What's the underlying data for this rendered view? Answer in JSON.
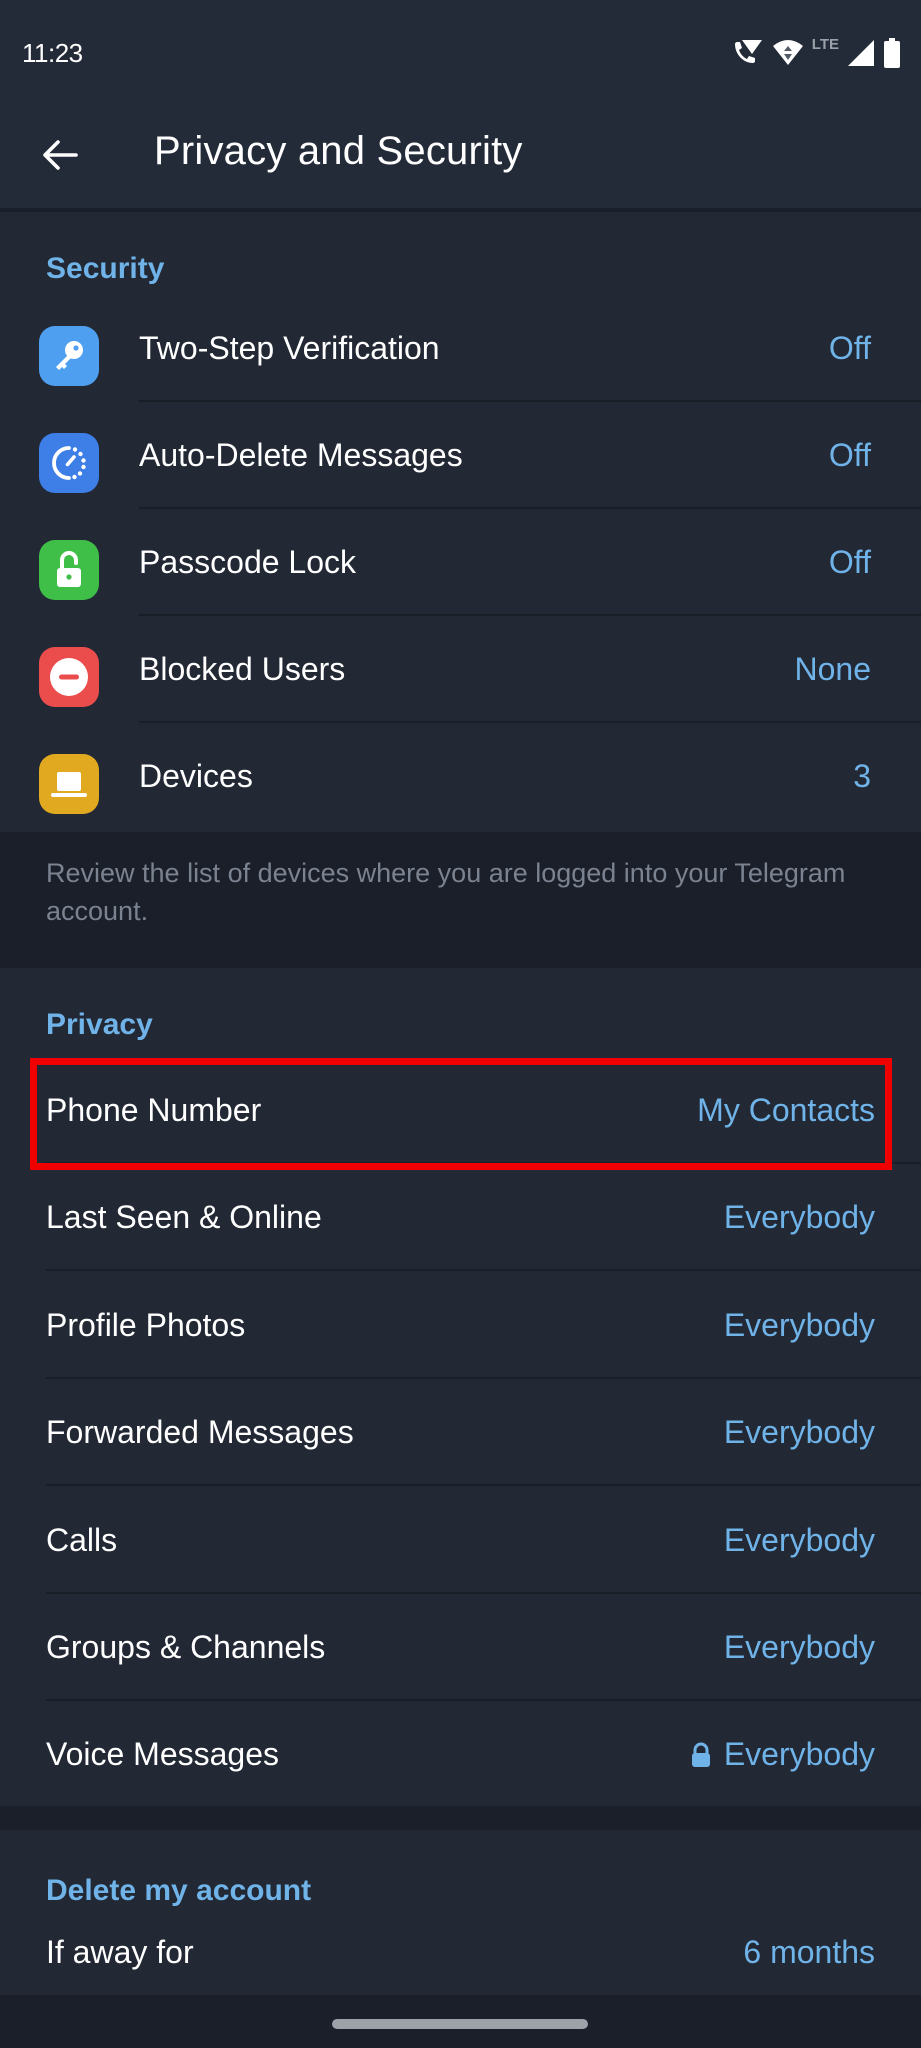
{
  "status_bar": {
    "time": "11:23",
    "network_label": "LTE",
    "icons": [
      "wifi-calling-icon",
      "wifi-icon",
      "signal-icon",
      "battery-icon"
    ]
  },
  "app_bar": {
    "back_icon": "arrow-left-icon",
    "title": "Privacy and Security"
  },
  "security": {
    "header": "Security",
    "items": [
      {
        "label": "Two-Step Verification",
        "value": "Off",
        "icon": "key-icon",
        "color": "#4f9ff0"
      },
      {
        "label": "Auto-Delete Messages",
        "value": "Off",
        "icon": "timer-icon",
        "color": "#3d7fe6"
      },
      {
        "label": "Passcode Lock",
        "value": "Off",
        "icon": "lock-open-icon",
        "color": "#3fbf48"
      },
      {
        "label": "Blocked Users",
        "value": "None",
        "icon": "block-icon",
        "color": "#eb4d4d"
      },
      {
        "label": "Devices",
        "value": "3",
        "icon": "laptop-icon",
        "color": "#e0a920"
      }
    ],
    "footer": "Review the list of devices where you are logged into your Telegram account."
  },
  "privacy": {
    "header": "Privacy",
    "items": [
      {
        "label": "Phone Number",
        "value": "My Contacts",
        "highlighted": true
      },
      {
        "label": "Last Seen & Online",
        "value": "Everybody"
      },
      {
        "label": "Profile Photos",
        "value": "Everybody"
      },
      {
        "label": "Forwarded Messages",
        "value": "Everybody"
      },
      {
        "label": "Calls",
        "value": "Everybody"
      },
      {
        "label": "Groups & Channels",
        "value": "Everybody"
      },
      {
        "label": "Voice Messages",
        "value": "Everybody",
        "locked": true
      }
    ]
  },
  "delete_account": {
    "header": "Delete my account",
    "items": [
      {
        "label": "If away for",
        "value": "6 months"
      }
    ]
  },
  "colors": {
    "accent": "#6fb3e8",
    "highlight_border": "#f10000",
    "background": "#1a1f29",
    "surface": "#222834"
  }
}
